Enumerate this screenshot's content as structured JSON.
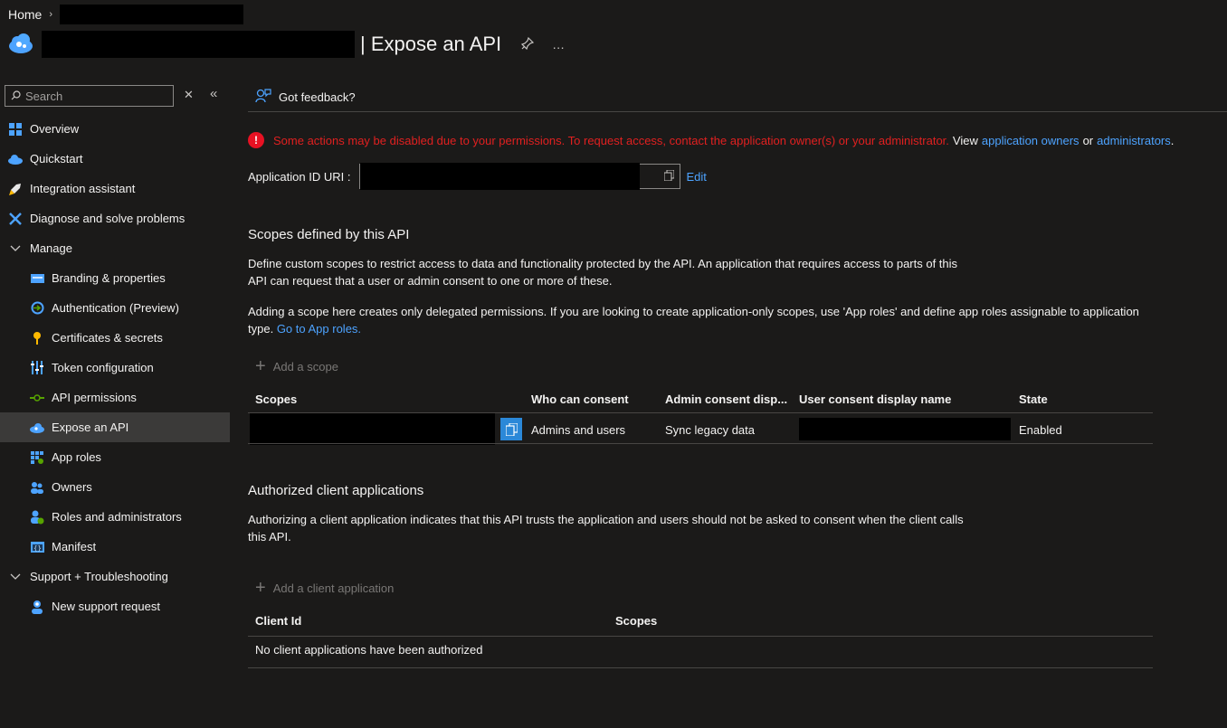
{
  "breadcrumb": {
    "home": "Home",
    "separator": "›"
  },
  "header": {
    "title": "| Expose an API",
    "pin_icon": "pin-icon",
    "more_icon": "…"
  },
  "sidebar": {
    "search_placeholder": "Search",
    "close": "✕",
    "collapse": "«",
    "items": [
      {
        "label": "Overview",
        "icon": "overview-icon",
        "color": "#4da3ff"
      },
      {
        "label": "Quickstart",
        "icon": "quickstart-icon",
        "color": "#4da3ff"
      },
      {
        "label": "Integration assistant",
        "icon": "rocket-icon",
        "color": "#ffb900"
      },
      {
        "label": "Diagnose and solve problems",
        "icon": "wrench-icon",
        "color": "#4da3ff"
      },
      {
        "label": "Manage",
        "icon": "chevron-down-icon"
      },
      {
        "label": "Branding & properties",
        "icon": "branding-icon",
        "color": "#4da3ff"
      },
      {
        "label": "Authentication (Preview)",
        "icon": "auth-icon",
        "color": "#4da3ff"
      },
      {
        "label": "Certificates & secrets",
        "icon": "key-icon",
        "color": "#ffb900"
      },
      {
        "label": "Token configuration",
        "icon": "token-icon",
        "color": "#4da3ff"
      },
      {
        "label": "API permissions",
        "icon": "api-permissions-icon",
        "color": "#57a300"
      },
      {
        "label": "Expose an API",
        "icon": "cloud-icon",
        "color": "#4da3ff"
      },
      {
        "label": "App roles",
        "icon": "app-roles-icon",
        "color": "#4da3ff"
      },
      {
        "label": "Owners",
        "icon": "owners-icon",
        "color": "#4da3ff"
      },
      {
        "label": "Roles and administrators",
        "icon": "roles-icon",
        "color": "#57a300"
      },
      {
        "label": "Manifest",
        "icon": "manifest-icon",
        "color": "#4da3ff"
      },
      {
        "label": "Support + Troubleshooting",
        "icon": "chevron-down-icon"
      },
      {
        "label": "New support request",
        "icon": "support-icon",
        "color": "#4da3ff"
      }
    ]
  },
  "toolbar": {
    "feedback": "Got feedback?"
  },
  "warning": {
    "text": "Some actions may be disabled due to your permissions. To request access, contact the application owner(s) or your administrator.",
    "view": "View",
    "owners_link": "application owners",
    "or": "or",
    "admins_link": "administrators",
    "period": "."
  },
  "uri": {
    "label": "Application ID URI :",
    "edit": "Edit"
  },
  "scopes": {
    "heading": "Scopes defined by this API",
    "desc1": "Define custom scopes to restrict access to data and functionality protected by the API. An application that requires access to parts of this API can request that a user or admin consent to one or more of these.",
    "desc2": "Adding a scope here creates only delegated permissions. If you are looking to create application-only scopes, use 'App roles' and define app roles assignable to application type.",
    "desc2_link": "Go to App roles.",
    "add": "Add a scope",
    "columns": [
      "Scopes",
      "Who can consent",
      "Admin consent disp...",
      "User consent display name",
      "State"
    ],
    "rows": [
      {
        "who": "Admins and users",
        "admin_name": "Sync legacy data",
        "state": "Enabled"
      }
    ]
  },
  "clients": {
    "heading": "Authorized client applications",
    "desc": "Authorizing a client application indicates that this API trusts the application and users should not be asked to consent when the client calls this API.",
    "add": "Add a client application",
    "columns": [
      "Client Id",
      "Scopes"
    ],
    "empty": "No client applications have been authorized"
  },
  "colors": {
    "accent": "#4da3ff",
    "error": "#e02020",
    "background": "#1b1a19"
  }
}
